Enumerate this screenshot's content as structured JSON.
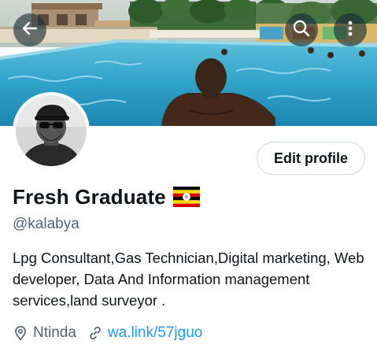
{
  "header": {
    "back_icon": "arrow-left-icon",
    "search_icon": "search-icon",
    "more_icon": "more-vertical-icon"
  },
  "profile": {
    "edit_label": "Edit profile",
    "name": "Fresh Graduate",
    "flag": "uganda-flag-icon",
    "handle": "@kalabya",
    "bio": "Lpg Consultant,Gas Technician,Digital marketing, Web developer, Data And Information management services,land surveyor .",
    "location": "Ntinda",
    "website": "wa.link/57jguo"
  },
  "colors": {
    "link": "#1d9bf0",
    "secondary_text": "#536471",
    "pool": "#2fa3c8"
  }
}
